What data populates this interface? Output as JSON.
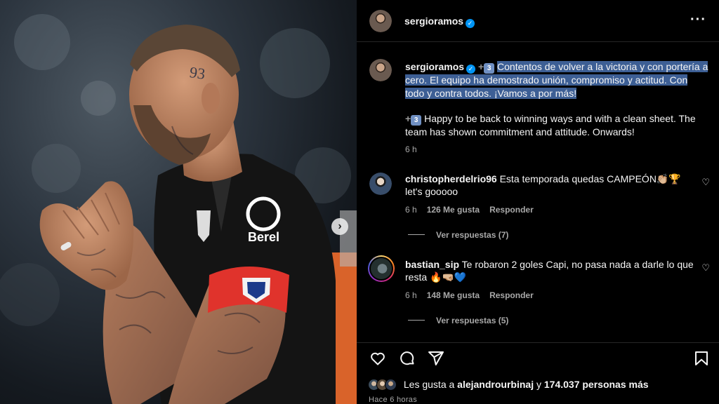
{
  "header": {
    "username": "sergioramos"
  },
  "caption": {
    "username": "sergioramos",
    "badge": "3",
    "text_es": "Contentos de volver a la victoria y con portería a cero. El equipo ha demostrado unión, compromiso y actitud. Con todo y contra todos. ¡Vamos a por más!",
    "text_en": "Happy to be back to winning ways and with a clean sheet. The team has shown commitment and attitude. Onwards!",
    "time": "6 h"
  },
  "photo": {
    "jersey_sponsor": "Berel",
    "tattoo": "93"
  },
  "comments": [
    {
      "username": "christopherdelrio96",
      "text": "Esta temporada quedas CAMPEÓN👏🏼🏆 let's gooooo",
      "time": "6 h",
      "likes": "126 Me gusta",
      "reply": "Responder",
      "view_replies": "Ver respuestas (7)"
    },
    {
      "username": "bastian_sip",
      "text": "Te robaron 2 goles Capi, no pasa nada a darle lo que resta 🔥🤜🏼💙",
      "time": "6 h",
      "likes": "148 Me gusta",
      "reply": "Responder",
      "view_replies": "Ver respuestas (5)"
    }
  ],
  "footer": {
    "likes_prefix": "Les gusta a",
    "liker": "alejandrourbinaj",
    "likes_mid": "y",
    "likes_count": "174.037 personas más",
    "time_ago": "Hace 6 horas"
  },
  "icons": [
    "more-options-icon",
    "verified-icon",
    "heart-icon",
    "comment-icon",
    "share-icon",
    "bookmark-icon",
    "next-photo-icon"
  ],
  "colors": {
    "verified": "#0095f6",
    "highlight": "#3d5f95",
    "armband": "#e0332c"
  }
}
